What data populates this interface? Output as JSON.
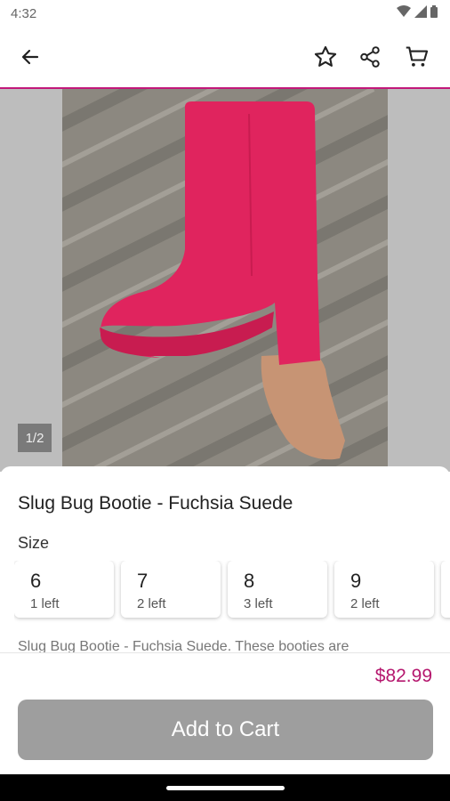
{
  "status_bar": {
    "time": "4:32"
  },
  "app_bar": {
    "back_icon": "arrow-left-icon",
    "favorite_icon": "star-outline-icon",
    "share_icon": "share-icon",
    "cart_icon": "cart-icon"
  },
  "gallery": {
    "counter": "1/2",
    "current_image": 1,
    "total_images": 2
  },
  "product": {
    "title": "Slug Bug Bootie - Fuchsia Suede",
    "size_label": "Size",
    "sizes": [
      {
        "size": "6",
        "stock": "1 left"
      },
      {
        "size": "7",
        "stock": "2 left"
      },
      {
        "size": "8",
        "stock": "3 left"
      },
      {
        "size": "9",
        "stock": "2 left"
      }
    ],
    "description": "Slug Bug Bootie - Fuchsia Suede. These booties are",
    "price": "$82.99",
    "add_to_cart": "Add to Cart"
  },
  "colors": {
    "accent": "#c2187a",
    "price": "#b5176e",
    "button_disabled": "#9e9e9e",
    "boot": "#e0245e"
  }
}
